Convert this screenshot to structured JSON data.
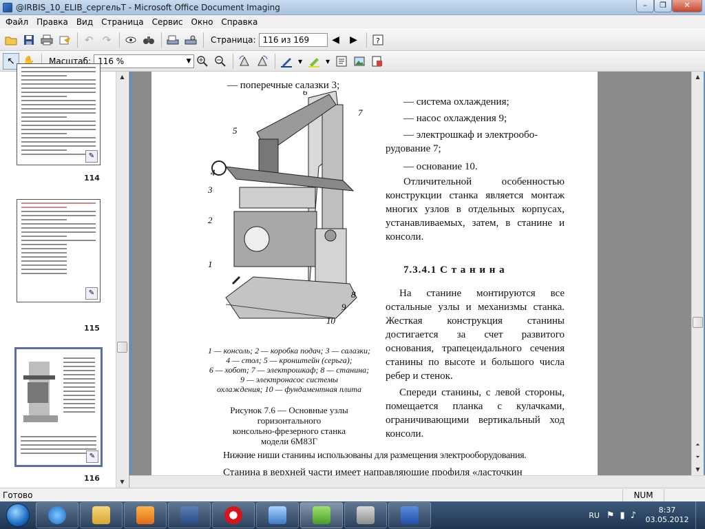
{
  "window": {
    "title": "@IRBIS_10_ELIB_сергельТ - Microsoft Office Document Imaging",
    "minimize": "–",
    "maximize": "❐",
    "close": "✕"
  },
  "menu": [
    "Файл",
    "Правка",
    "Вид",
    "Страница",
    "Сервис",
    "Окно",
    "Справка"
  ],
  "toolbar1": {
    "page_label": "Страница:",
    "page_value": "116 из 169"
  },
  "toolbar2": {
    "zoom_label": "Масштаб:",
    "zoom_value": "116 %"
  },
  "thumbnails": [
    {
      "number": "114",
      "selected": false
    },
    {
      "number": "115",
      "selected": false
    },
    {
      "number": "116",
      "selected": true
    }
  ],
  "document": {
    "line_top": "— поперечные салазки 3;",
    "right_list": [
      "— система охлаждения;",
      "— насос охлаждения 9;",
      "— электрошкаф и электрообо-",
      "рудование 7;",
      "— основание 10."
    ],
    "para1": "Отличительной особенностью конструкции станка является монтаж многих узлов в отдельных корпусах, устанавливаемых, затем, в станине и консоли.",
    "section_title": "7.3.4.1 С т а н и н а",
    "para2": "На станине монтируются все остальные узлы и механизмы станка. Жесткая конструкция станины достигается за счет развитого основания, трапецеидального сечения станины по высоте и большого числа ребер и стенок.",
    "para3": "Спереди станины, с левой стороны, помещается планка с кулачками, ограничивающими вертикальный ход консоли.",
    "legend": [
      "1 — консоль; 2 — коробка подач; 3 — салазки;",
      "4 — стол; 5 — кронштейн (серьга);",
      "6 — хобот; 7 — электрошкаф; 8 — станина;",
      "9 — электронасос системы",
      "охлаждения; 10 — фундаментная плита"
    ],
    "figure_caption": [
      "Рисунок 7.6 — Основные узлы",
      "горизонтального",
      "консольно-фрезерного станка",
      "модели 6М83Г"
    ],
    "line_bottom1": "Нижние ниши станины использованы для размещения электрооборудования.",
    "line_bottom2": "Станина в верхней части имеет направляющие профиля «ласточкин",
    "figure_labels": [
      "1",
      "2",
      "3",
      "4",
      "5",
      "6",
      "7",
      "8",
      "9",
      "10"
    ]
  },
  "status": {
    "text": "Готово",
    "num": "NUM"
  },
  "taskbar": {
    "language": "RU",
    "time": "8:37",
    "date": "03.05.2012"
  }
}
